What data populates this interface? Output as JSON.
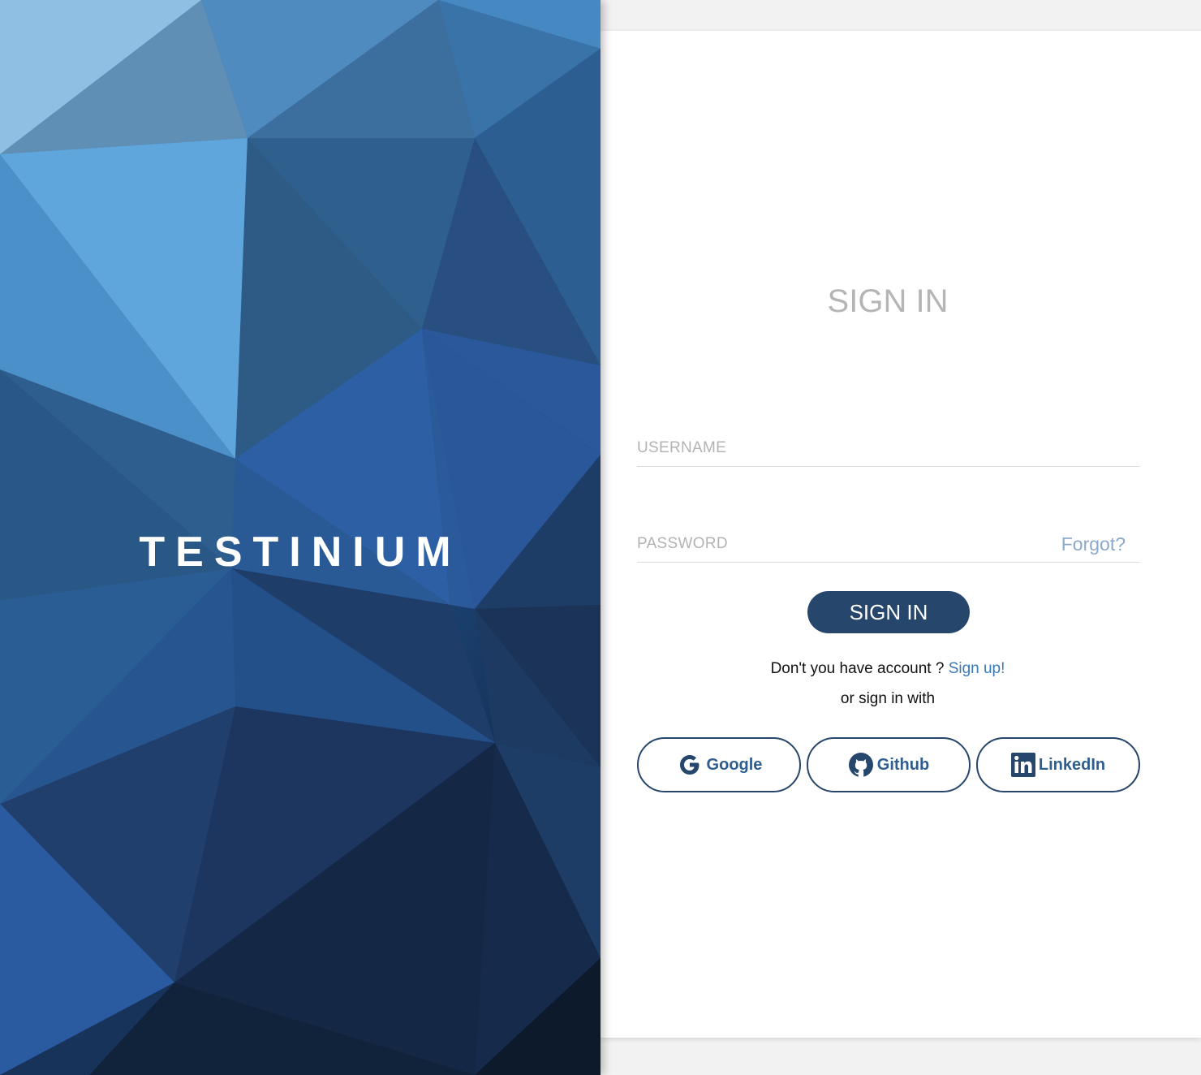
{
  "brand": {
    "name": "TESTINIUM"
  },
  "signin": {
    "title": "SIGN IN",
    "username_placeholder": "USERNAME",
    "password_placeholder": "PASSWORD",
    "forgot_label": "Forgot?",
    "submit_label": "SIGN IN",
    "no_account_text": "Don't you have account ?",
    "signup_label": "Sign up!",
    "or_sign_in_with": "or sign in with"
  },
  "social": [
    {
      "label": "Google",
      "icon": "google-icon"
    },
    {
      "label": "Github",
      "icon": "github-icon"
    },
    {
      "label": "LinkedIn",
      "icon": "linkedin-icon"
    }
  ],
  "colors": {
    "primary": "#26466b",
    "link": "#3b78b5",
    "muted_link": "#8ba9c8",
    "title": "#b5b5b5"
  }
}
